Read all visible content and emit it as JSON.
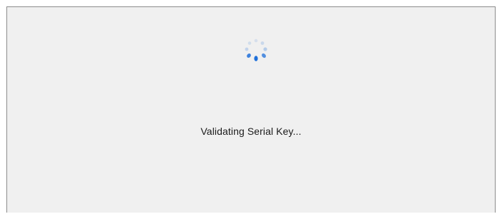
{
  "dialog": {
    "status_text": "Validating Serial Key...",
    "spinner_icon": "loading-spinner-icon",
    "background_color": "#f0f0f0",
    "spinner_color": "#1e6fd9"
  }
}
